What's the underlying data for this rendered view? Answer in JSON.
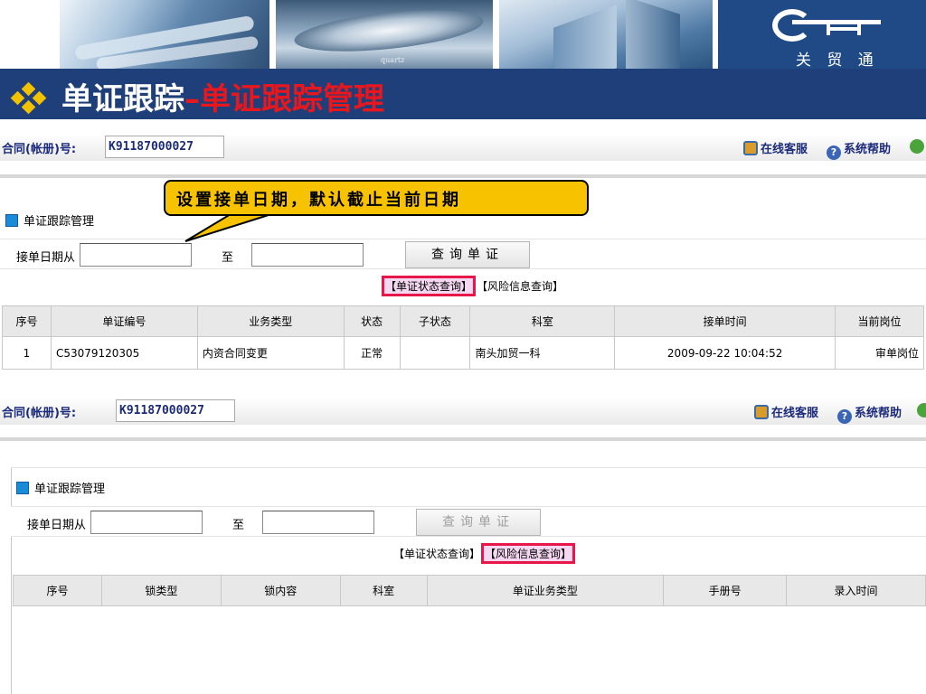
{
  "banner": {
    "photo_caption": "quartz",
    "logo_text": "关 贸 通"
  },
  "title": {
    "main": "单证跟踪",
    "sub": "–单证跟踪管理"
  },
  "panel1": {
    "contract_label": "合同(帐册)号:",
    "contract_value": "K91187000027",
    "online_service": "在线客服",
    "system_help": "系统帮助",
    "section_title": "单证跟踪管理",
    "date_from_label": "接单日期从",
    "date_to_label": "至",
    "query_button": "查询单证",
    "tab_status": "【单证状态查询】",
    "tab_risk": "【风险信息查询】",
    "columns": [
      "序号",
      "单证编号",
      "业务类型",
      "状态",
      "子状态",
      "科室",
      "接单时间",
      "当前岗位"
    ],
    "rows": [
      [
        "1",
        "C53079120305",
        "内资合同变更",
        "正常",
        "",
        "南头加贸一科",
        "2009-09-22 10:04:52",
        "审单岗位"
      ]
    ]
  },
  "callout": {
    "text": "设置接单日期，默认截止当前日期"
  },
  "panel2": {
    "contract_label": "合同(帐册)号:",
    "contract_value": "K91187000027",
    "online_service": "在线客服",
    "system_help": "系统帮助",
    "section_title": "单证跟踪管理",
    "date_from_label": "接单日期从",
    "date_to_label": "至",
    "query_button": "查询单证",
    "tab_status": "【单证状态查询】",
    "tab_risk": "【风险信息查询】",
    "columns": [
      "序号",
      "锁类型",
      "锁内容",
      "科室",
      "单证业务类型",
      "手册号",
      "录入时间"
    ]
  },
  "colors": {
    "title_bar": "#1f3f7a",
    "title_accent": "#e8171d",
    "callout_fill": "#f7c200",
    "tab_highlight_border": "#e8174a",
    "label_blue": "#1b2a7a"
  }
}
